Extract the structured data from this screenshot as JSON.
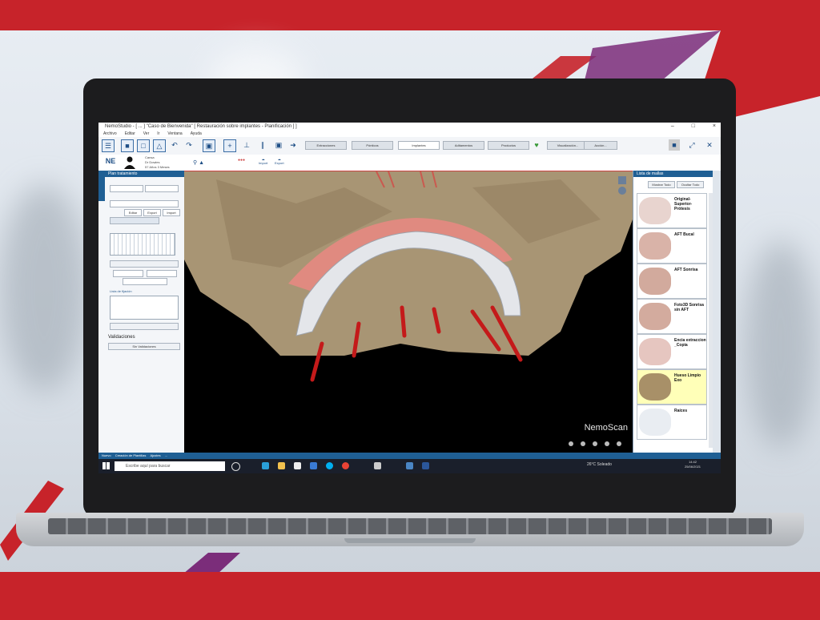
{
  "app": {
    "title": "NemoStudio - [ ... ] \"Caso de Bienvenida\" [ Restauración sobre implantes - Planificación ] ]",
    "window_controls": [
      "–",
      "□",
      "×"
    ]
  },
  "menu": [
    "Archivo",
    "Editar",
    "Ver",
    "Ir",
    "Ventana",
    "Ayuda"
  ],
  "toolbar": {
    "tabs": [
      "Extracciones",
      "Pónticos",
      "Implantes",
      "Aditamentos",
      "Productos",
      "Visualización...",
      "Acción..."
    ],
    "active_tab": "Implantes"
  },
  "patient": {
    "initials": "NE",
    "line1": "Cansa",
    "line2": "Dr Dowies",
    "line3": "57 Años 3 Meses",
    "import_label": "Import",
    "export_label": "Export"
  },
  "left_panel": {
    "title": "Plan tratamiento",
    "section_label": "Lista de fijación",
    "validations_label": "Validaciones",
    "validations_value": "Sin Validaciones",
    "buttons": [
      "Editar",
      "Export",
      "Import"
    ]
  },
  "viewport": {
    "brand": "NemoScan"
  },
  "mesh_list": {
    "title": "Lista de mallas",
    "show_all": "Mostrar Todo",
    "hide_all": "Ocultar Todo",
    "items": [
      {
        "label": "Original-Superior-Prótesis",
        "selected": false,
        "color": "#e8d4cf"
      },
      {
        "label": "AFT Bucal",
        "selected": false,
        "color": "#d9b3a8"
      },
      {
        "label": "AFT Sonrisa",
        "selected": false,
        "color": "#d2aa9d"
      },
      {
        "label": "Foto3D Sonrisa sin AFT",
        "selected": false,
        "color": "#d3ab9e"
      },
      {
        "label": "Encia extraccion _Copia",
        "selected": false,
        "color": "#e6c6c0"
      },
      {
        "label": "Hueso Limpio Exo",
        "selected": true,
        "color": "#a89068"
      },
      {
        "label": "Raíces",
        "selected": false,
        "color": "#e9edf2"
      }
    ]
  },
  "status_tabs": [
    "Nuevo",
    "Creación de Plantillas",
    "Ajustes",
    "..."
  ],
  "taskbar": {
    "search_placeholder": "Escribe aquí para buscar",
    "weather": "26°C  Soleado",
    "time": "14:42",
    "date": "25/06/2021"
  }
}
